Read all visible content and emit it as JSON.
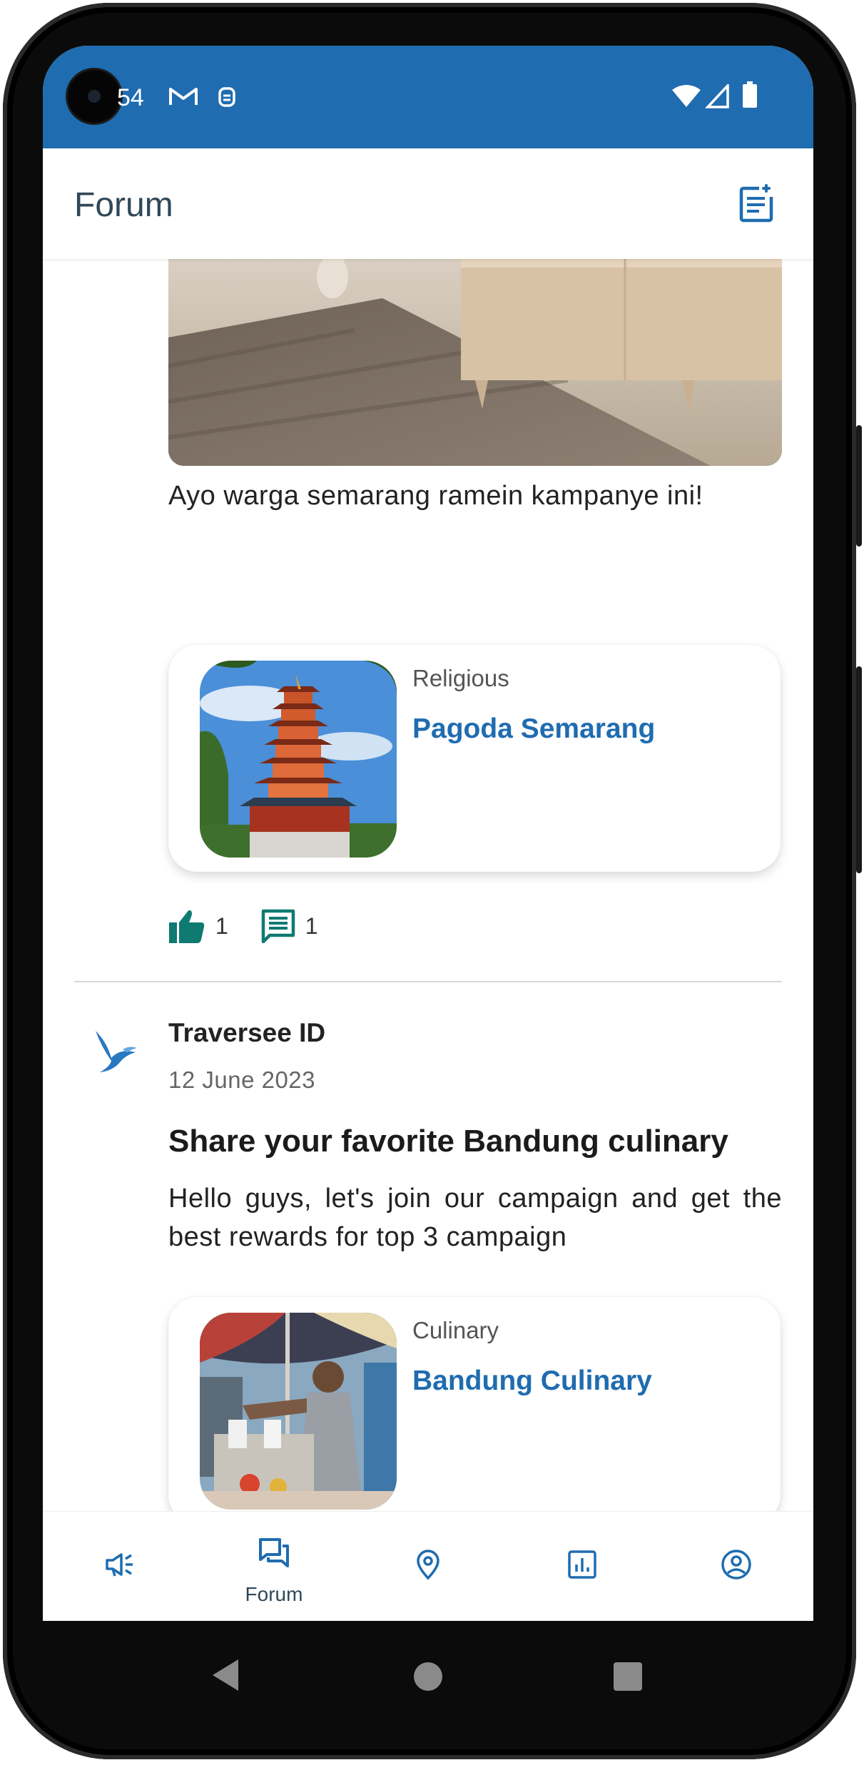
{
  "status_bar": {
    "time": "54"
  },
  "app_bar": {
    "title": "Forum"
  },
  "posts": [
    {
      "text": "Ayo warga semarang ramein kampanye ini!",
      "place": {
        "category": "Religious",
        "name": "Pagoda Semarang"
      },
      "likes": "1",
      "comments": "1"
    },
    {
      "author": "Traversee ID",
      "date": "12 June 2023",
      "title": "Share your favorite Bandung culinary",
      "text": "Hello guys, let's join our campaign and get the best rewards for top 3 campaign",
      "place": {
        "category": "Culinary",
        "name": "Bandung Culinary"
      }
    }
  ],
  "bottom_nav": [
    {
      "label": "",
      "icon": "campaign-icon"
    },
    {
      "label": "Forum",
      "icon": "forum-icon",
      "active": true
    },
    {
      "label": "",
      "icon": "location-icon"
    },
    {
      "label": "",
      "icon": "leaderboard-icon"
    },
    {
      "label": "",
      "icon": "profile-icon"
    }
  ],
  "colors": {
    "primary": "#1f6cb0",
    "accent_green": "#0e7a72",
    "title_text": "#2f4858"
  }
}
